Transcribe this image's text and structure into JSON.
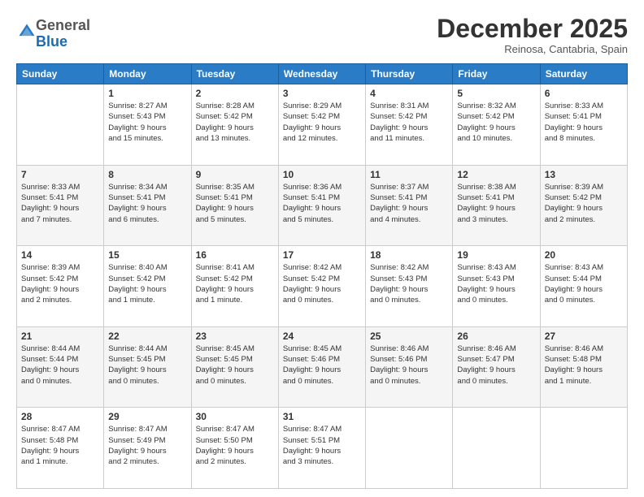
{
  "logo": {
    "general": "General",
    "blue": "Blue"
  },
  "header": {
    "month": "December 2025",
    "location": "Reinosa, Cantabria, Spain"
  },
  "weekdays": [
    "Sunday",
    "Monday",
    "Tuesday",
    "Wednesday",
    "Thursday",
    "Friday",
    "Saturday"
  ],
  "weeks": [
    [
      {
        "day": "",
        "info": ""
      },
      {
        "day": "1",
        "info": "Sunrise: 8:27 AM\nSunset: 5:43 PM\nDaylight: 9 hours\nand 15 minutes."
      },
      {
        "day": "2",
        "info": "Sunrise: 8:28 AM\nSunset: 5:42 PM\nDaylight: 9 hours\nand 13 minutes."
      },
      {
        "day": "3",
        "info": "Sunrise: 8:29 AM\nSunset: 5:42 PM\nDaylight: 9 hours\nand 12 minutes."
      },
      {
        "day": "4",
        "info": "Sunrise: 8:31 AM\nSunset: 5:42 PM\nDaylight: 9 hours\nand 11 minutes."
      },
      {
        "day": "5",
        "info": "Sunrise: 8:32 AM\nSunset: 5:42 PM\nDaylight: 9 hours\nand 10 minutes."
      },
      {
        "day": "6",
        "info": "Sunrise: 8:33 AM\nSunset: 5:41 PM\nDaylight: 9 hours\nand 8 minutes."
      }
    ],
    [
      {
        "day": "7",
        "info": "Sunrise: 8:33 AM\nSunset: 5:41 PM\nDaylight: 9 hours\nand 7 minutes."
      },
      {
        "day": "8",
        "info": "Sunrise: 8:34 AM\nSunset: 5:41 PM\nDaylight: 9 hours\nand 6 minutes."
      },
      {
        "day": "9",
        "info": "Sunrise: 8:35 AM\nSunset: 5:41 PM\nDaylight: 9 hours\nand 5 minutes."
      },
      {
        "day": "10",
        "info": "Sunrise: 8:36 AM\nSunset: 5:41 PM\nDaylight: 9 hours\nand 5 minutes."
      },
      {
        "day": "11",
        "info": "Sunrise: 8:37 AM\nSunset: 5:41 PM\nDaylight: 9 hours\nand 4 minutes."
      },
      {
        "day": "12",
        "info": "Sunrise: 8:38 AM\nSunset: 5:41 PM\nDaylight: 9 hours\nand 3 minutes."
      },
      {
        "day": "13",
        "info": "Sunrise: 8:39 AM\nSunset: 5:42 PM\nDaylight: 9 hours\nand 2 minutes."
      }
    ],
    [
      {
        "day": "14",
        "info": "Sunrise: 8:39 AM\nSunset: 5:42 PM\nDaylight: 9 hours\nand 2 minutes."
      },
      {
        "day": "15",
        "info": "Sunrise: 8:40 AM\nSunset: 5:42 PM\nDaylight: 9 hours\nand 1 minute."
      },
      {
        "day": "16",
        "info": "Sunrise: 8:41 AM\nSunset: 5:42 PM\nDaylight: 9 hours\nand 1 minute."
      },
      {
        "day": "17",
        "info": "Sunrise: 8:42 AM\nSunset: 5:42 PM\nDaylight: 9 hours\nand 0 minutes."
      },
      {
        "day": "18",
        "info": "Sunrise: 8:42 AM\nSunset: 5:43 PM\nDaylight: 9 hours\nand 0 minutes."
      },
      {
        "day": "19",
        "info": "Sunrise: 8:43 AM\nSunset: 5:43 PM\nDaylight: 9 hours\nand 0 minutes."
      },
      {
        "day": "20",
        "info": "Sunrise: 8:43 AM\nSunset: 5:44 PM\nDaylight: 9 hours\nand 0 minutes."
      }
    ],
    [
      {
        "day": "21",
        "info": "Sunrise: 8:44 AM\nSunset: 5:44 PM\nDaylight: 9 hours\nand 0 minutes."
      },
      {
        "day": "22",
        "info": "Sunrise: 8:44 AM\nSunset: 5:45 PM\nDaylight: 9 hours\nand 0 minutes."
      },
      {
        "day": "23",
        "info": "Sunrise: 8:45 AM\nSunset: 5:45 PM\nDaylight: 9 hours\nand 0 minutes."
      },
      {
        "day": "24",
        "info": "Sunrise: 8:45 AM\nSunset: 5:46 PM\nDaylight: 9 hours\nand 0 minutes."
      },
      {
        "day": "25",
        "info": "Sunrise: 8:46 AM\nSunset: 5:46 PM\nDaylight: 9 hours\nand 0 minutes."
      },
      {
        "day": "26",
        "info": "Sunrise: 8:46 AM\nSunset: 5:47 PM\nDaylight: 9 hours\nand 0 minutes."
      },
      {
        "day": "27",
        "info": "Sunrise: 8:46 AM\nSunset: 5:48 PM\nDaylight: 9 hours\nand 1 minute."
      }
    ],
    [
      {
        "day": "28",
        "info": "Sunrise: 8:47 AM\nSunset: 5:48 PM\nDaylight: 9 hours\nand 1 minute."
      },
      {
        "day": "29",
        "info": "Sunrise: 8:47 AM\nSunset: 5:49 PM\nDaylight: 9 hours\nand 2 minutes."
      },
      {
        "day": "30",
        "info": "Sunrise: 8:47 AM\nSunset: 5:50 PM\nDaylight: 9 hours\nand 2 minutes."
      },
      {
        "day": "31",
        "info": "Sunrise: 8:47 AM\nSunset: 5:51 PM\nDaylight: 9 hours\nand 3 minutes."
      },
      {
        "day": "",
        "info": ""
      },
      {
        "day": "",
        "info": ""
      },
      {
        "day": "",
        "info": ""
      }
    ]
  ]
}
